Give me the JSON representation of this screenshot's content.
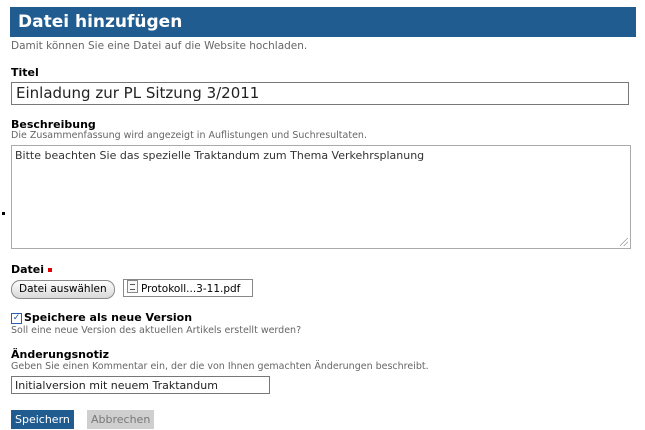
{
  "header": {
    "title": "Datei hinzufügen"
  },
  "intro": "Damit können Sie eine Datei auf die Website hochladen.",
  "fields": {
    "titel": {
      "label": "Titel",
      "value": "Einladung zur PL Sitzung 3/2011"
    },
    "beschreibung": {
      "label": "Beschreibung",
      "help": "Die Zusammenfassung wird angezeigt in Auflistungen und Suchresultaten.",
      "value": "Bitte beachten Sie das spezielle Traktandum zum Thema Verkehrsplanung"
    },
    "datei": {
      "label": "Datei",
      "button_label": "Datei auswählen",
      "file_name": "Protokoll...3-11.pdf",
      "required_color": "#e00000"
    },
    "version": {
      "checked": true,
      "label": "Speichere als neue Version",
      "help": "Soll eine neue Version des aktuellen Artikels erstellt werden?"
    },
    "notiz": {
      "label": "Änderungsnotiz",
      "help": "Geben Sie einen Kommentar ein, der die von Ihnen gemachten Änderungen beschreibt.",
      "value": "Initialversion mit neuem Traktandum"
    }
  },
  "buttons": {
    "save": "Speichern",
    "cancel": "Abbrechen"
  },
  "colors": {
    "header_bg": "#205c90",
    "save_bg": "#205c90",
    "cancel_bg": "#cfcfcf"
  },
  "icons": {
    "file": "pdf-file-icon",
    "resize": "resize-handle-icon",
    "check": "checkmark-icon"
  }
}
